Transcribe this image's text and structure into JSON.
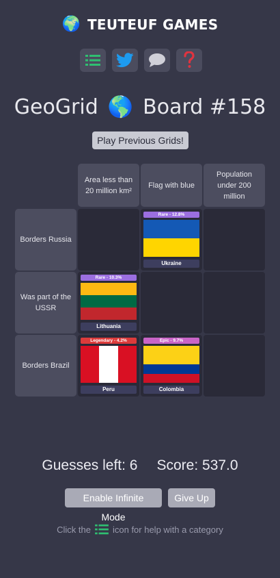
{
  "brand": {
    "name": "TEUTEUF GAMES",
    "icon": "globe-icon"
  },
  "toolbar": {
    "buttons": [
      {
        "icon": "list-icon",
        "color": "#2fbf71"
      },
      {
        "icon": "twitter-bird-icon",
        "color": "#1d9bf0"
      },
      {
        "icon": "speech-bubble-icon",
        "color": "#d0d0d8"
      },
      {
        "icon": "question-mark-icon",
        "color": "#e0333f"
      }
    ]
  },
  "title": {
    "left": "GeoGrid",
    "right": "Board #158"
  },
  "prev_button": "Play Previous Grids!",
  "columns": [
    {
      "label": "Area less than 20 million km²"
    },
    {
      "label": "Flag with blue"
    },
    {
      "label": "Population under 200 million"
    }
  ],
  "rows": [
    {
      "label": "Borders Russia"
    },
    {
      "label": "Was part of the USSR"
    },
    {
      "label": "Borders Brazil"
    }
  ],
  "answers": {
    "r1c2": {
      "rarity": "Rare - 12.8%",
      "rarity_color": "#9b6fe0",
      "country": "Ukraine"
    },
    "r2c1": {
      "rarity": "Rare - 10.3%",
      "rarity_color": "#9b6fe0",
      "country": "Lithuania"
    },
    "r3c1": {
      "rarity": "Legendary - 4.2%",
      "rarity_color": "#dc3b3b",
      "country": "Peru"
    },
    "r3c2": {
      "rarity": "Epic - 9.7%",
      "rarity_color": "#c964c7",
      "country": "Colombia"
    }
  },
  "stats": {
    "guesses": "Guesses left: 6",
    "score": "Score: 537.0"
  },
  "actions": {
    "infinite": "Enable Infinite Mode",
    "give_up": "Give Up"
  },
  "help": {
    "before": "Click the",
    "after": "icon for help with a category"
  },
  "colors": {
    "background": "#363748",
    "header_tile": "#4c4d5f",
    "empty_cell": "#2a2a38",
    "accent_green": "#2fbf71"
  }
}
